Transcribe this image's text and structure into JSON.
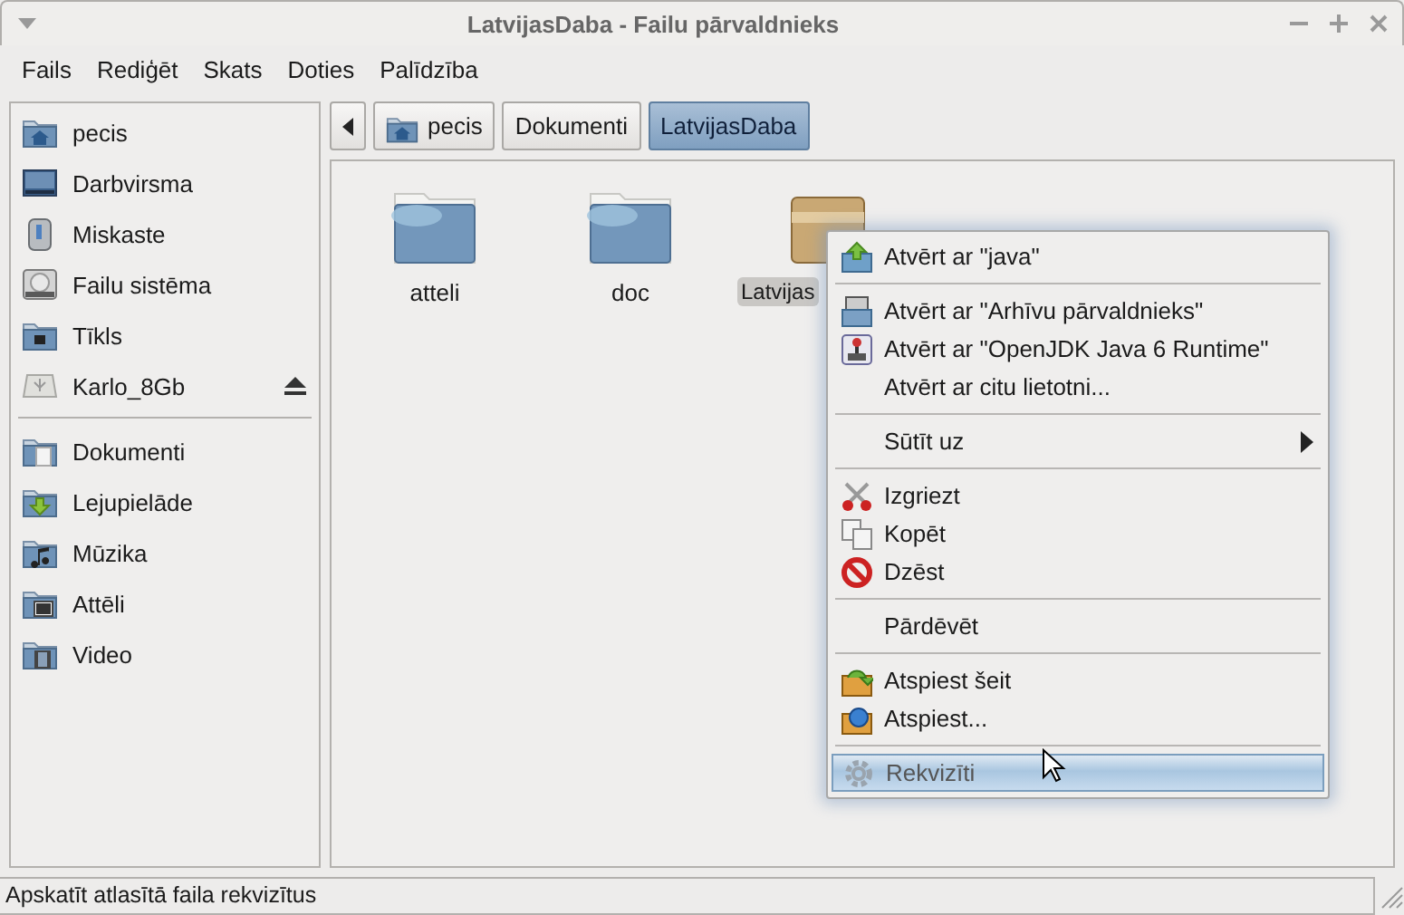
{
  "window": {
    "title": "LatvijasDaba - Failu pārvaldnieks"
  },
  "menubar": [
    "Fails",
    "Rediģēt",
    "Skats",
    "Doties",
    "Palīdzība"
  ],
  "sidebar": {
    "places": [
      {
        "label": "pecis",
        "eject": false
      },
      {
        "label": "Darbvirsma",
        "eject": false
      },
      {
        "label": "Miskaste",
        "eject": false
      },
      {
        "label": "Failu sistēma",
        "eject": false
      },
      {
        "label": "Tīkls",
        "eject": false
      },
      {
        "label": "Karlo_8Gb",
        "eject": true
      }
    ],
    "bookmarks": [
      {
        "label": "Dokumenti"
      },
      {
        "label": "Lejupielāde"
      },
      {
        "label": "Mūzika"
      },
      {
        "label": "Attēli"
      },
      {
        "label": "Video"
      }
    ]
  },
  "pathbar": {
    "crumbs": [
      {
        "label": "pecis",
        "selected": false
      },
      {
        "label": "Dokumenti",
        "selected": false
      },
      {
        "label": "LatvijasDaba",
        "selected": true
      }
    ]
  },
  "files": [
    {
      "name": "atteli",
      "kind": "folder",
      "selected": false
    },
    {
      "name": "doc",
      "kind": "folder",
      "selected": false
    },
    {
      "name": "Latvijas",
      "kind": "archive",
      "selected": true
    }
  ],
  "context_menu": [
    {
      "kind": "item",
      "label": "Atvērt ar \"java\"",
      "selected": false
    },
    {
      "kind": "separator"
    },
    {
      "kind": "item",
      "label": "Atvērt ar \"Arhīvu pārvaldnieks\"",
      "selected": false
    },
    {
      "kind": "item",
      "label": "Atvērt ar \"OpenJDK Java 6 Runtime\"",
      "selected": false
    },
    {
      "kind": "item",
      "label": "Atvērt ar citu lietotni...",
      "selected": false
    },
    {
      "kind": "separator"
    },
    {
      "kind": "submenu",
      "label": "Sūtīt uz",
      "selected": false
    },
    {
      "kind": "separator"
    },
    {
      "kind": "item",
      "label": "Izgriezt",
      "selected": false
    },
    {
      "kind": "item",
      "label": "Kopēt",
      "selected": false
    },
    {
      "kind": "item",
      "label": "Dzēst",
      "selected": false
    },
    {
      "kind": "separator"
    },
    {
      "kind": "item",
      "label": "Pārdēvēt",
      "selected": false
    },
    {
      "kind": "separator"
    },
    {
      "kind": "item",
      "label": "Atspiest šeit",
      "selected": false
    },
    {
      "kind": "item",
      "label": "Atspiest...",
      "selected": false
    },
    {
      "kind": "separator"
    },
    {
      "kind": "item",
      "label": "Rekvizīti",
      "selected": true
    }
  ],
  "status_bar": "Apskatīt atlasītā faila rekvizītus"
}
